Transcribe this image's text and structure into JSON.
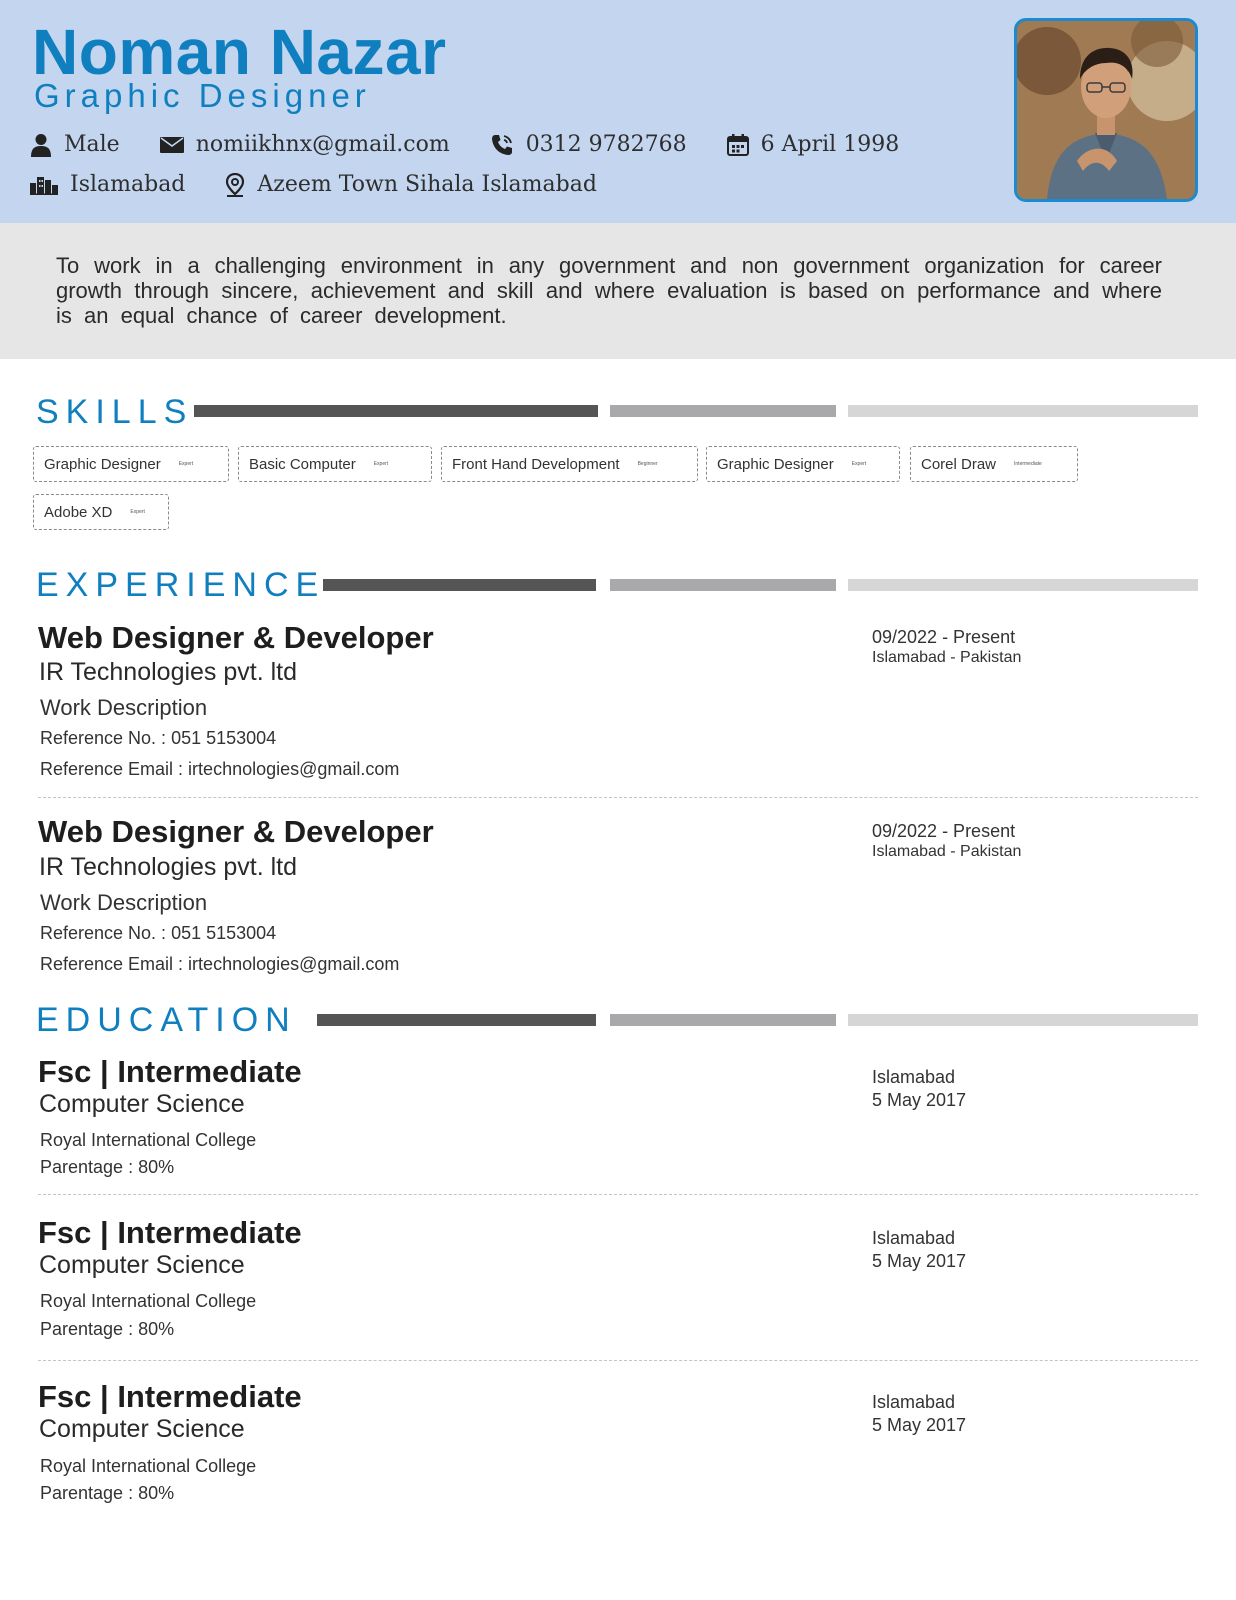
{
  "header": {
    "name": "Noman Nazar",
    "role": "Graphic Designer",
    "gender": "Male",
    "email": "nomiikhnx@gmail.com",
    "phone": "0312 9782768",
    "dob": "6 April 1998",
    "city": "Islamabad",
    "address": "Azeem Town Sihala Islamabad",
    "icons": [
      "person-icon",
      "envelope-icon",
      "phone-icon",
      "calendar-icon",
      "city-icon",
      "location-pin-icon"
    ]
  },
  "objective": "To work in a challenging environment in any government and non government organization for career growth through sincere, achievement and skill and where evaluation is based on performance and where is an equal chance of career development.",
  "skills": {
    "title": "SKILLS",
    "items": [
      {
        "name": "Graphic Designer",
        "level": "Expert"
      },
      {
        "name": "Basic Computer",
        "level": "Expert"
      },
      {
        "name": "Front Hand Development",
        "level": "Beginner"
      },
      {
        "name": "Graphic Designer",
        "level": "Expert"
      },
      {
        "name": "Corel Draw",
        "level": "Intermediate"
      },
      {
        "name": "Adobe XD",
        "level": "Expert"
      }
    ]
  },
  "experience": {
    "title": "EXPERIENCE",
    "items": [
      {
        "title": "Web Designer & Developer",
        "company": "IR Technologies pvt. ltd",
        "description": "Work Description",
        "ref_no": "Reference No. : 051 5153004",
        "ref_email": "Reference Email : irtechnologies@gmail.com",
        "period": "09/2022 - Present",
        "location": "Islamabad - Pakistan"
      },
      {
        "title": "Web Designer & Developer",
        "company": "IR Technologies pvt. ltd",
        "description": "Work Description",
        "ref_no": "Reference No. : 051 5153004",
        "ref_email": "Reference Email : irtechnologies@gmail.com",
        "period": "09/2022 - Present",
        "location": "Islamabad - Pakistan"
      }
    ]
  },
  "education": {
    "title": "EDUCATION",
    "items": [
      {
        "title": "Fsc | Intermediate",
        "field": "Computer Science",
        "institute": "Royal International College",
        "percentage": "Parentage : 80%",
        "city": "Islamabad",
        "date": "5 May 2017"
      },
      {
        "title": "Fsc | Intermediate",
        "field": "Computer Science",
        "institute": "Royal International College",
        "percentage": "Parentage : 80%",
        "city": "Islamabad",
        "date": "5 May 2017"
      },
      {
        "title": "Fsc | Intermediate",
        "field": "Computer Science",
        "institute": "Royal International College",
        "percentage": "Parentage : 80%",
        "city": "Islamabad",
        "date": "5 May 2017"
      }
    ]
  },
  "colors": {
    "accent": "#0f7fc0",
    "header_bg": "#c4d6ef",
    "objective_bg": "#e6e6e6"
  }
}
